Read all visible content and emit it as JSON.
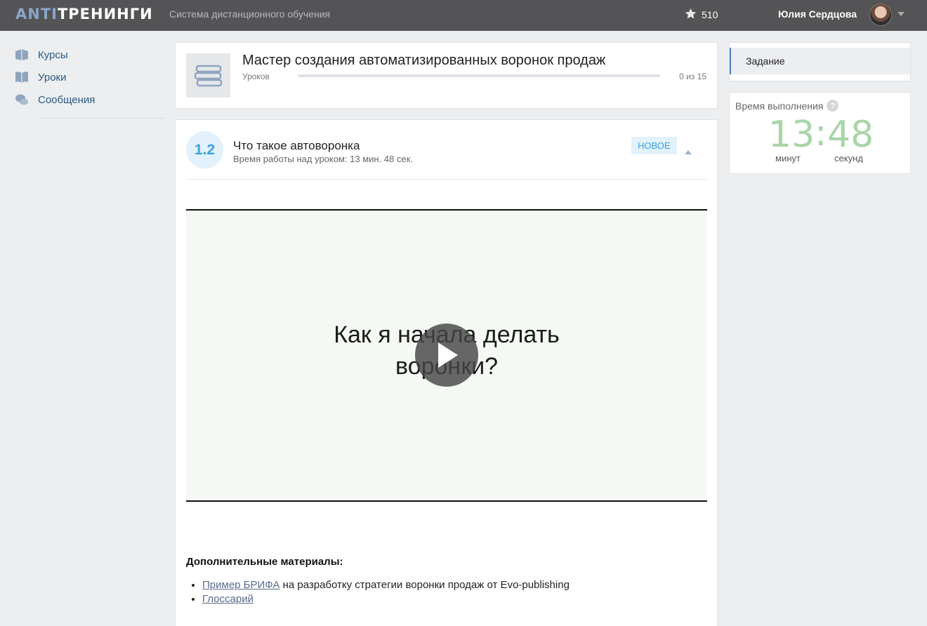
{
  "header": {
    "logo_part1": "ANTI",
    "logo_part2": "ТРЕНИНГИ",
    "tagline": "Система дистанционного обучения",
    "stars_count": "510",
    "username": "Юлия Сердцова"
  },
  "nav": {
    "items": [
      {
        "label": "Курсы",
        "icon": "courses-icon"
      },
      {
        "label": "Уроки",
        "icon": "book-icon"
      },
      {
        "label": "Сообщения",
        "icon": "messages-icon"
      }
    ]
  },
  "course": {
    "title": "Мастер создания автоматизированных воронок продаж",
    "lessons_label": "Уроков",
    "progress_text": "0 из 15",
    "progress_fraction": 0
  },
  "lesson": {
    "number": "1.2",
    "title": "Что такое автоворонка",
    "time_spent": "Время работы над уроком: 13 мин. 48 сек.",
    "badge": "НОВОЕ",
    "video_title_line1": "Как я начала делать",
    "video_title_line2": "воронки?",
    "materials_title": "Дополнительные материалы:",
    "materials": [
      {
        "link": "Пример БРИФА",
        "text": " на разработку стратегии воронки продаж от Evo-publishing"
      },
      {
        "link": "Глоссарий",
        "text": ""
      }
    ]
  },
  "sidebar": {
    "task_label": "Задание",
    "timer_label": "Время выполнения",
    "timer_help": "?",
    "minutes": "13",
    "seconds": "48",
    "colon": ":",
    "minutes_unit": "минут",
    "seconds_unit": "секунд"
  },
  "colors": {
    "accent": "#5181b8",
    "badge_text": "#3aa3dc",
    "timer_green": "#a8d5a8"
  }
}
